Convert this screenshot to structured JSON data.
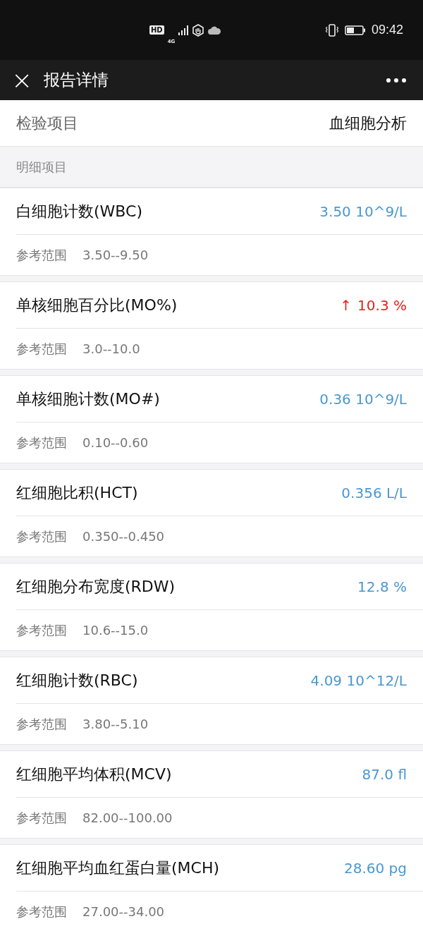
{
  "status_bar": {
    "time": "09:42",
    "network": "4G",
    "hd": "HD"
  },
  "nav": {
    "title": "报告详情",
    "close": "×"
  },
  "header": {
    "label": "检验项目",
    "value": "血细胞分析"
  },
  "section": {
    "title": "明细项目"
  },
  "items": [
    {
      "name": "白细胞计数(WBC)",
      "value": "3.50 10^9/L",
      "abnormal": false,
      "ref_label": "参考范围",
      "ref": "3.50--9.50"
    },
    {
      "name": "单核细胞百分比(MO%)",
      "arrow": "↑",
      "value": "10.3 %",
      "abnormal": true,
      "ref_label": "参考范围",
      "ref": "3.0--10.0"
    },
    {
      "name": "单核细胞计数(MO#)",
      "value": "0.36 10^9/L",
      "abnormal": false,
      "ref_label": "参考范围",
      "ref": "0.10--0.60"
    },
    {
      "name": "红细胞比积(HCT)",
      "value": "0.356 L/L",
      "abnormal": false,
      "ref_label": "参考范围",
      "ref": "0.350--0.450"
    },
    {
      "name": "红细胞分布宽度(RDW)",
      "value": "12.8 %",
      "abnormal": false,
      "ref_label": "参考范围",
      "ref": "10.6--15.0"
    },
    {
      "name": "红细胞计数(RBC)",
      "value": "4.09 10^12/L",
      "abnormal": false,
      "ref_label": "参考范围",
      "ref": "3.80--5.10"
    },
    {
      "name": "红细胞平均体积(MCV)",
      "value": "87.0 fl",
      "abnormal": false,
      "ref_label": "参考范围",
      "ref": "82.00--100.00"
    },
    {
      "name": "红细胞平均血红蛋白量(MCH)",
      "value": "28.60 pg",
      "abnormal": false,
      "ref_label": "参考范围",
      "ref": "27.00--34.00"
    }
  ]
}
